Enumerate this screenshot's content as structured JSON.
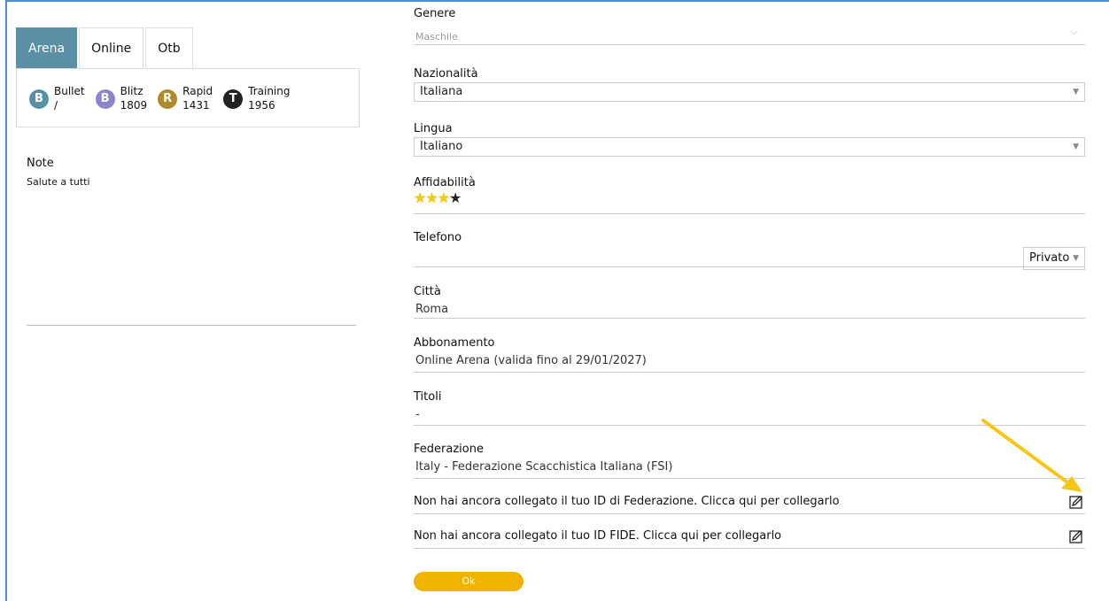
{
  "tabs": [
    "Arena",
    "Online",
    "Otb"
  ],
  "ratings": [
    {
      "letter": "B",
      "name": "Bullet",
      "value": "/",
      "color": "#5b8fa5"
    },
    {
      "letter": "B",
      "name": "Blitz",
      "value": "1809",
      "color": "#8b86c9"
    },
    {
      "letter": "R",
      "name": "Rapid",
      "value": "1431",
      "color": "#b08a2a"
    },
    {
      "letter": "T",
      "name": "Training",
      "value": "1956",
      "color": "#222222"
    }
  ],
  "note": {
    "title": "Note",
    "text": "Salute a tutti"
  },
  "form": {
    "genere": {
      "label": "Genere",
      "value": "Maschile"
    },
    "nazionalita": {
      "label": "Nazionalità",
      "value": "Italiana"
    },
    "lingua": {
      "label": "Lingua",
      "value": "Italiano"
    },
    "affidabilita": {
      "label": "Affidabilità",
      "stars_on": 3,
      "stars_total": 4
    },
    "telefono": {
      "label": "Telefono",
      "privacy": "Privato"
    },
    "citta": {
      "label": "Città",
      "value": "Roma"
    },
    "abbonamento": {
      "label": "Abbonamento",
      "value": "Online Arena (valida fino al 29/01/2027)"
    },
    "titoli": {
      "label": "Titoli",
      "value": "-"
    },
    "federazione": {
      "label": "Federazione",
      "value": "Italy - Federazione Scacchistica Italiana (FSI)"
    }
  },
  "links": {
    "federation_id": "Non hai ancora collegato il tuo ID di Federazione. Clicca qui per collegarlo",
    "fide_id": "Non hai ancora collegato il tuo ID FIDE. Clicca qui per collegarlo"
  },
  "ok_label": "Ok",
  "colors": {
    "accent": "#f2b300",
    "tab_active": "#5b8fa5",
    "arrow": "#f5c518"
  }
}
